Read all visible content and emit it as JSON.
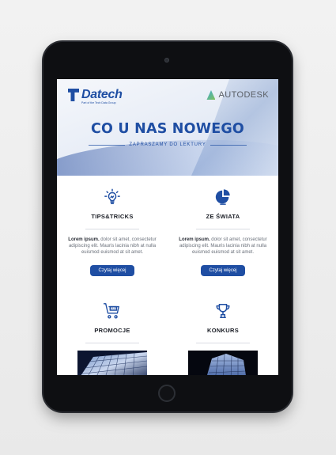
{
  "brand": {
    "name": "Datech",
    "tagline": "Part of the Tech Data Group",
    "partner": "AUTODESK",
    "primary_color": "#1f4ea3"
  },
  "hero": {
    "title": "CO U NAS NOWEGO",
    "subtitle": "ZAPRASZAMY DO LEKTURY"
  },
  "cards": [
    {
      "icon": "lightbulb-icon",
      "title": "TIPS&TRICKS",
      "bold": "Lorem ipsum.",
      "text": " dolor sit amet, consectetur adipiscing elit. Mauris lacinia nibh at nulla euismod euismod at sit amet.",
      "button": "Czytaj więcej"
    },
    {
      "icon": "globe-chart-icon",
      "title": "ZE ŚWIATA",
      "bold": "Lorem ipsum.",
      "text": " dolor sit amet, consectetur adipiscing elit. Mauris lacinia nibh at nulla euismod euismod at sit amet.",
      "button": "Czytaj więcej"
    },
    {
      "icon": "sale-cart-icon",
      "title": "PROMOCJE",
      "badge": "SALE"
    },
    {
      "icon": "trophy-icon",
      "title": "KONKURS"
    }
  ]
}
